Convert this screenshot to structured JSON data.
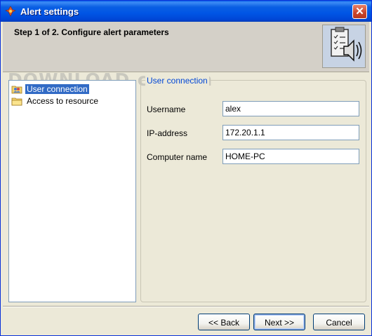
{
  "window": {
    "title": "Alert settings",
    "close_label": "✕"
  },
  "header": {
    "step_title": "Step 1 of 2. Configure alert parameters",
    "icon": "clipboard-speaker-icon"
  },
  "sidebar": {
    "items": [
      {
        "label": "User connection",
        "icon": "users-folder-icon",
        "selected": true
      },
      {
        "label": "Access to resource",
        "icon": "folder-icon",
        "selected": false
      }
    ]
  },
  "panel": {
    "title": "User connection",
    "fields": [
      {
        "label": "Username",
        "value": "alex"
      },
      {
        "label": "IP-address",
        "value": "172.20.1.1"
      },
      {
        "label": "Computer name",
        "value": "HOME-PC"
      }
    ]
  },
  "buttons": {
    "back": "<< Back",
    "next": "Next >>",
    "cancel": "Cancel"
  },
  "watermark": "DOWNLOAD.com.vn",
  "colors": {
    "titlebar": "#0055e5",
    "selection": "#316ac5",
    "group_title": "#0046d5"
  }
}
